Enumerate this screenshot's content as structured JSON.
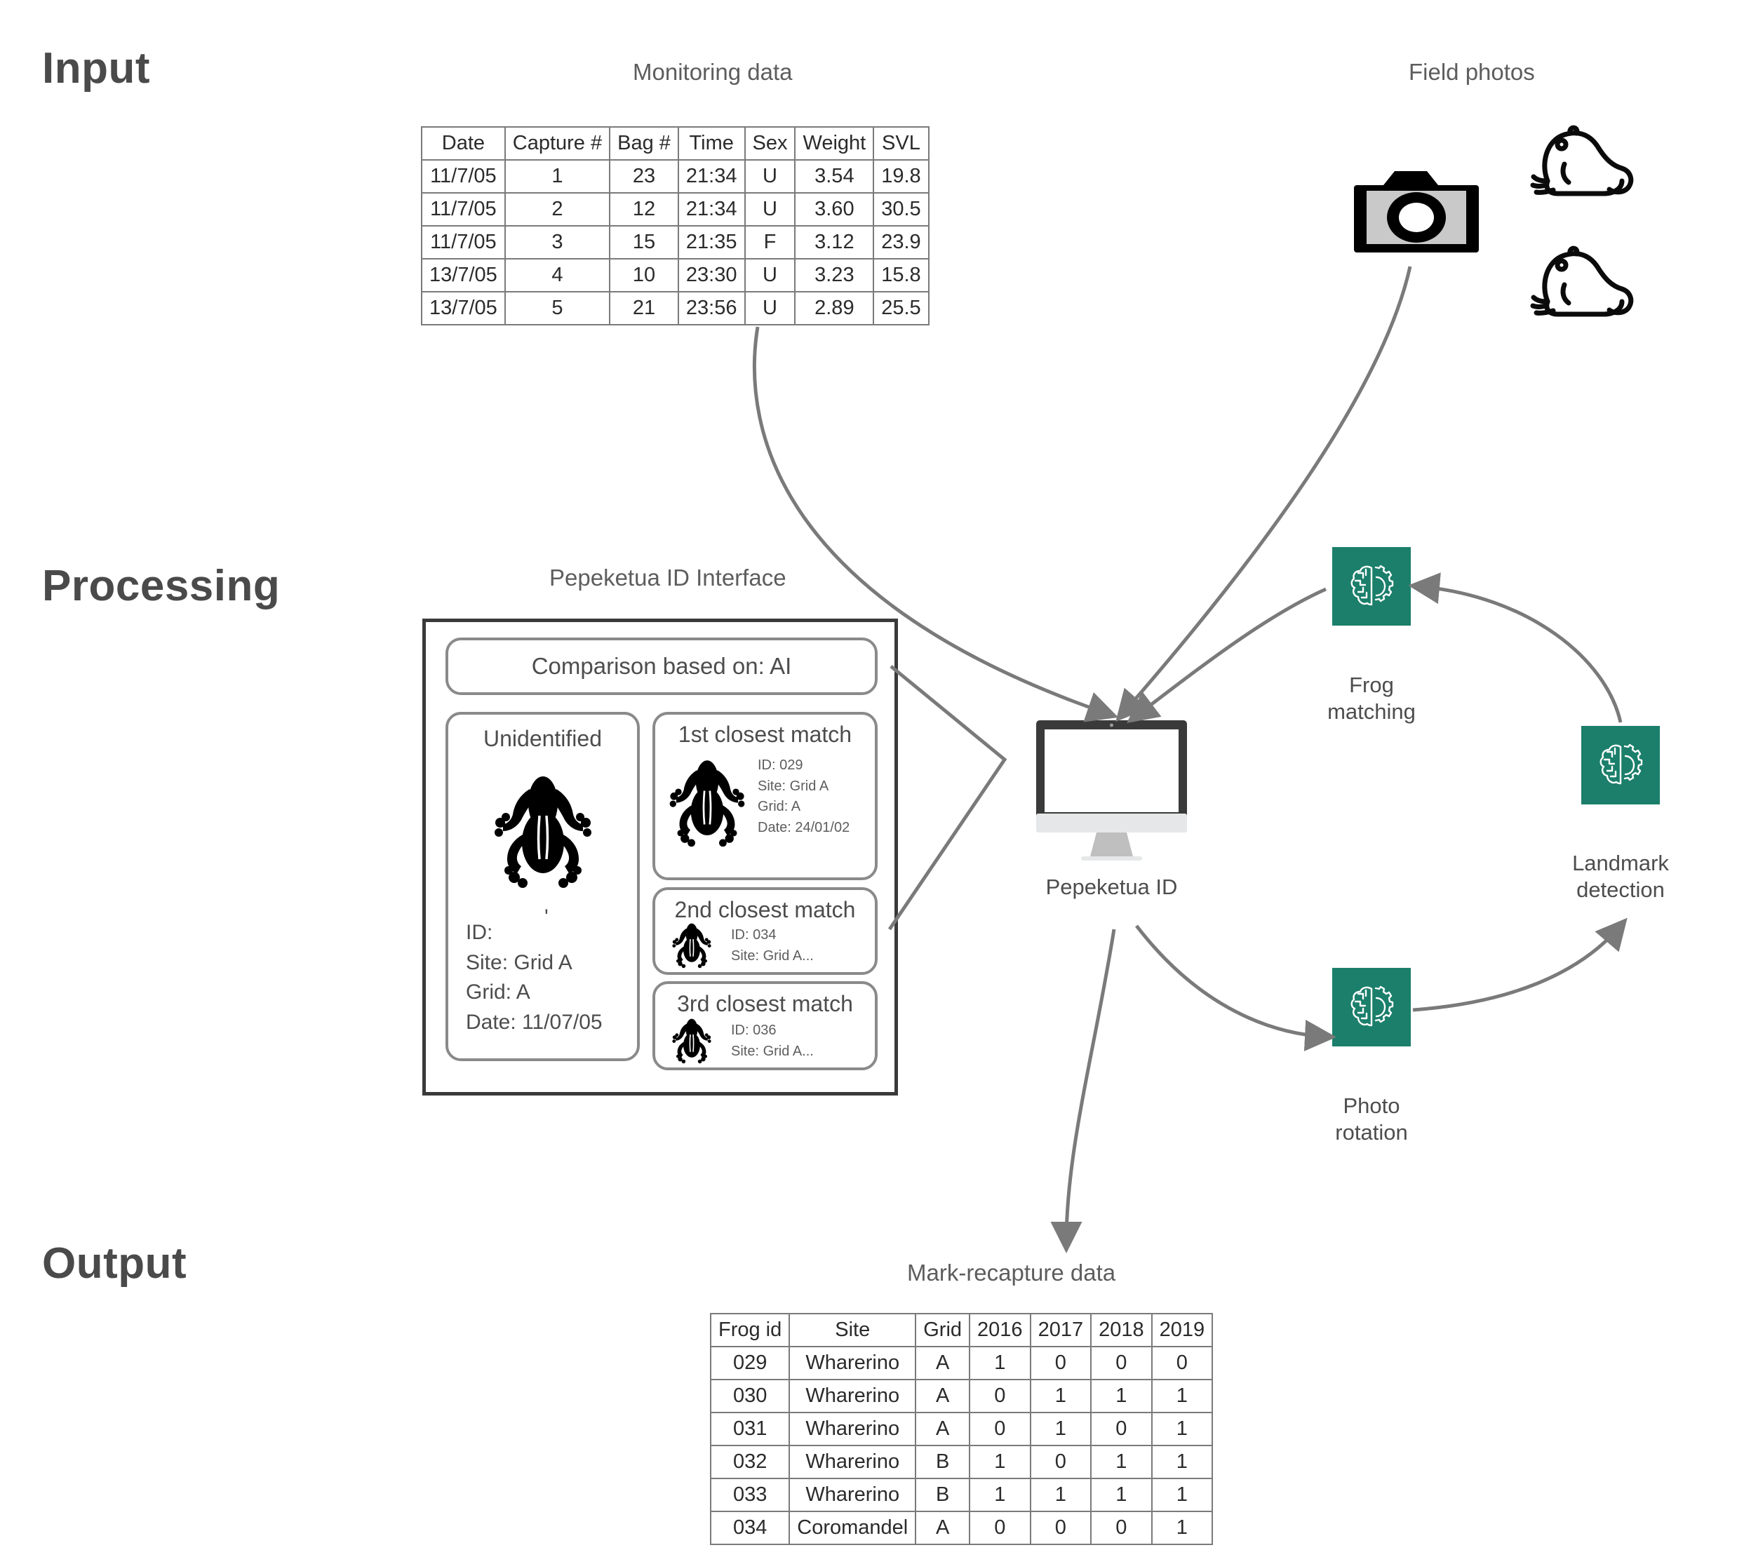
{
  "stages": {
    "input": "Input",
    "processing": "Processing",
    "output": "Output"
  },
  "captions": {
    "monitoring_data": "Monitoring data",
    "field_photos": "Field photos",
    "interface": "Pepeketua ID Interface",
    "mark_recapture": "Mark-recapture data"
  },
  "colors": {
    "accent_green": "#1b7f6b",
    "arrow_grey": "#7a7a7a",
    "text_grey": "#4d4d4d",
    "monitor_dark": "#3a3a3a",
    "monitor_base": "#e6e7e8"
  },
  "monitoring_table": {
    "headers": [
      "Date",
      "Capture #",
      "Bag #",
      "Time",
      "Sex",
      "Weight",
      "SVL"
    ],
    "rows": [
      [
        "11/7/05",
        "1",
        "23",
        "21:34",
        "U",
        "3.54",
        "19.8"
      ],
      [
        "11/7/05",
        "2",
        "12",
        "21:34",
        "U",
        "3.60",
        "30.5"
      ],
      [
        "11/7/05",
        "3",
        "15",
        "21:35",
        "F",
        "3.12",
        "23.9"
      ],
      [
        "13/7/05",
        "4",
        "10",
        "23:30",
        "U",
        "3.23",
        "15.8"
      ],
      [
        "13/7/05",
        "5",
        "21",
        "23:56",
        "U",
        "2.89",
        "25.5"
      ]
    ]
  },
  "output_table": {
    "headers": [
      "Frog id",
      "Site",
      "Grid",
      "2016",
      "2017",
      "2018",
      "2019"
    ],
    "rows": [
      [
        "029",
        "Wharerino",
        "A",
        "1",
        "0",
        "0",
        "0"
      ],
      [
        "030",
        "Wharerino",
        "A",
        "0",
        "1",
        "1",
        "1"
      ],
      [
        "031",
        "Wharerino",
        "A",
        "0",
        "1",
        "0",
        "1"
      ],
      [
        "032",
        "Wharerino",
        "B",
        "1",
        "0",
        "1",
        "1"
      ],
      [
        "033",
        "Wharerino",
        "B",
        "1",
        "1",
        "1",
        "1"
      ],
      [
        "034",
        "Coromandel",
        "A",
        "0",
        "0",
        "0",
        "1"
      ]
    ]
  },
  "interface": {
    "comparison": "Comparison based on: AI",
    "unidentified": {
      "title": "Unidentified",
      "tick": "'",
      "id": "ID:",
      "site": "Site: Grid A",
      "grid": "Grid: A",
      "date": "Date: 11/07/05"
    },
    "matches": [
      {
        "title": "1st closest match",
        "id": "ID:  029",
        "site": "Site: Grid A",
        "grid": "Grid: A",
        "date": "Date: 24/01/02"
      },
      {
        "title": "2nd closest match",
        "id": "ID:  034",
        "site": "Site: Grid A..."
      },
      {
        "title": "3rd closest match",
        "id": "ID:  036",
        "site": "Site: Grid A..."
      }
    ]
  },
  "pipeline": {
    "monitor_label": "Pepeketua ID",
    "frog_matching": "Frog\nmatching",
    "frog_matching_l1": "Frog",
    "frog_matching_l2": "matching",
    "landmark_l1": "Landmark",
    "landmark_l2": "detection",
    "photo_rotation_l1": "Photo",
    "photo_rotation_l2": "rotation"
  },
  "icons": {
    "camera": "camera-icon",
    "frog_outline": "frog-outline-icon",
    "frog_silhouette": "frog-silhouette-icon",
    "brain_gear": "brain-gear-ai-icon",
    "monitor": "desktop-monitor-icon"
  }
}
